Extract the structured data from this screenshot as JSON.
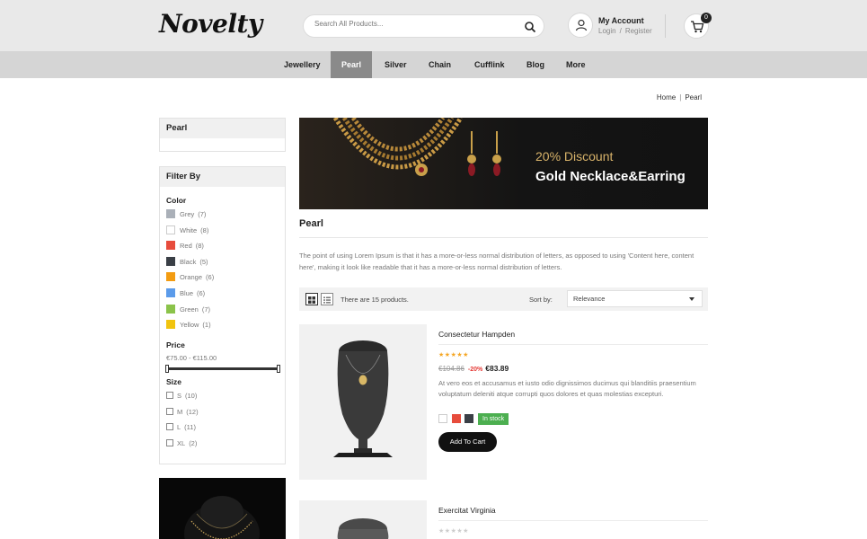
{
  "header": {
    "logo": "Novelty",
    "search_placeholder": "Search All Products...",
    "account_title": "My Account",
    "login": "Login",
    "link_sep": "/",
    "register": "Register",
    "cart_count": "0"
  },
  "nav": {
    "items": [
      "Jewellery",
      "Pearl",
      "Silver",
      "Chain",
      "Cufflink",
      "Blog",
      "More"
    ],
    "active": "Pearl"
  },
  "breadcrumb": {
    "home": "Home",
    "sep": "|",
    "current": "Pearl"
  },
  "sidebar": {
    "category_title": "Pearl",
    "filter_title": "Filter By",
    "color_title": "Color",
    "colors": [
      {
        "label": "Grey",
        "count": "(7)",
        "hex": "#aab0b8"
      },
      {
        "label": "White",
        "count": "(8)",
        "hex": "#ffffff"
      },
      {
        "label": "Red",
        "count": "(8)",
        "hex": "#e74c3c"
      },
      {
        "label": "Black",
        "count": "(5)",
        "hex": "#3a3f46"
      },
      {
        "label": "Orange",
        "count": "(6)",
        "hex": "#f39c12"
      },
      {
        "label": "Blue",
        "count": "(6)",
        "hex": "#5b9bea"
      },
      {
        "label": "Green",
        "count": "(7)",
        "hex": "#8bc34a"
      },
      {
        "label": "Yellow",
        "count": "(1)",
        "hex": "#f1c40f"
      }
    ],
    "price_title": "Price",
    "price_range": "€75.00 - €115.00",
    "size_title": "Size",
    "sizes": [
      {
        "label": "S",
        "count": "(10)"
      },
      {
        "label": "M",
        "count": "(12)"
      },
      {
        "label": "L",
        "count": "(11)"
      },
      {
        "label": "XL",
        "count": "(2)"
      }
    ]
  },
  "banner": {
    "discount": "20% Discount",
    "headline": "Gold Necklace&Earring"
  },
  "category": {
    "title": "Pearl",
    "description": "The point of using Lorem Ipsum is that it has a more-or-less normal distribution of letters, as opposed to using 'Content here, content here', making it look like readable that it has a more-or-less normal distribution of letters."
  },
  "toolbar": {
    "product_count": "There are 15 products.",
    "sort_label": "Sort by:",
    "sort_value": "Relevance"
  },
  "products": [
    {
      "name": "Consectetur Hampden",
      "rating": 5,
      "old_price": "€104.86",
      "discount": "-20%",
      "price": "€83.89",
      "description": "At vero eos et accusamus et iusto odio dignissimos ducimus qui blanditiis praesentium voluptatum deleniti atque corrupti quos dolores et quas molestias excepturi.",
      "variants": [
        "#ffffff",
        "#e74c3c",
        "#3a3f46"
      ],
      "stock": "In stock",
      "add_to_cart": "Add To Cart"
    },
    {
      "name": "Exercitat Virginia",
      "rating": 0
    }
  ],
  "colors": {
    "accent": "#8a8a8a",
    "star": "#f5a623",
    "stock": "#4caf50",
    "discount": "#e53935",
    "banner_gold": "#d8b36a"
  }
}
